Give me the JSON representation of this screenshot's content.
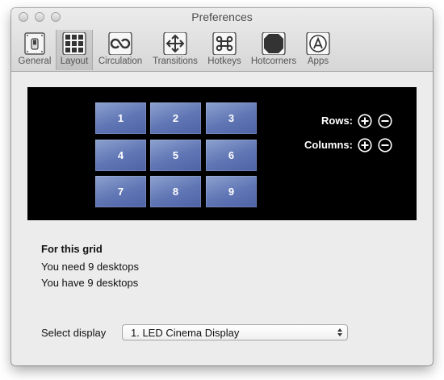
{
  "window": {
    "title": "Preferences"
  },
  "toolbar": {
    "tabs": [
      {
        "label": "General",
        "icon": "switch-icon"
      },
      {
        "label": "Layout",
        "icon": "grid-icon",
        "selected": true
      },
      {
        "label": "Circulation",
        "icon": "loop-icon"
      },
      {
        "label": "Transitions",
        "icon": "move-arrows-icon"
      },
      {
        "label": "Hotkeys",
        "icon": "command-icon"
      },
      {
        "label": "Hotcorners",
        "icon": "hotcorners-icon"
      },
      {
        "label": "Apps",
        "icon": "app-store-icon"
      }
    ]
  },
  "grid": {
    "tiles": [
      "1",
      "2",
      "3",
      "4",
      "5",
      "6",
      "7",
      "8",
      "9"
    ],
    "rows_label": "Rows:",
    "columns_label": "Columns:"
  },
  "info": {
    "title": "For this grid",
    "need": "You need 9 desktops",
    "have": "You have 9 desktops"
  },
  "display": {
    "label": "Select display",
    "selected": "1. LED Cinema Display"
  }
}
